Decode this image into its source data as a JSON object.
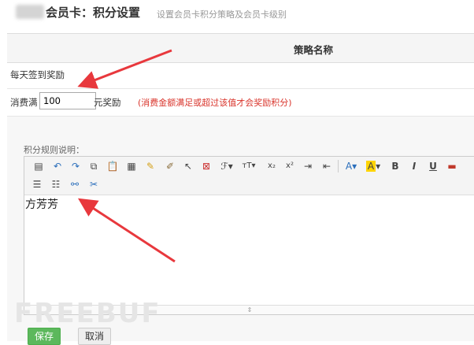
{
  "header": {
    "title": "会员卡：积分设置",
    "subtitle": "设置会员卡积分策略及会员卡级别"
  },
  "table": {
    "header": "策略名称",
    "row_signin": "每天签到奖励",
    "row_spend": {
      "label": "消费满",
      "value": "100",
      "unit": "元奖励",
      "hint": "(消费金额满足或超过该值才会奖励积分)"
    }
  },
  "rules": {
    "label": "积分规则说明：",
    "content": "方芳芳"
  },
  "editor_toolbar": {
    "row1": [
      "source-icon",
      "undo-icon",
      "redo-icon",
      "copy-icon",
      "paste-icon",
      "paste-text-icon",
      "clear-format-icon",
      "format-painter-icon",
      "select-all-icon",
      "remove-icon",
      "font-family-icon",
      "font-size-icon",
      "subscript-icon",
      "superscript-icon",
      "indent-icon",
      "outdent-icon",
      "font-color-icon",
      "highlight-icon",
      "bold-icon",
      "italic-icon",
      "underline-icon",
      "hr-icon"
    ],
    "row2": [
      "ordered-list-icon",
      "unordered-list-icon",
      "link-icon",
      "unlink-icon"
    ],
    "bold": "B",
    "italic": "I",
    "underline": "U",
    "font_color": "A",
    "highlight": "A",
    "superscript": "x²",
    "subscript": "x₂"
  },
  "buttons": {
    "save": "保存",
    "cancel": "取消"
  },
  "watermark": "FREEBUF",
  "colors": {
    "accent_red": "#d9342b",
    "save_green": "#5cb85c",
    "header_bg": "#f5f5f5"
  }
}
